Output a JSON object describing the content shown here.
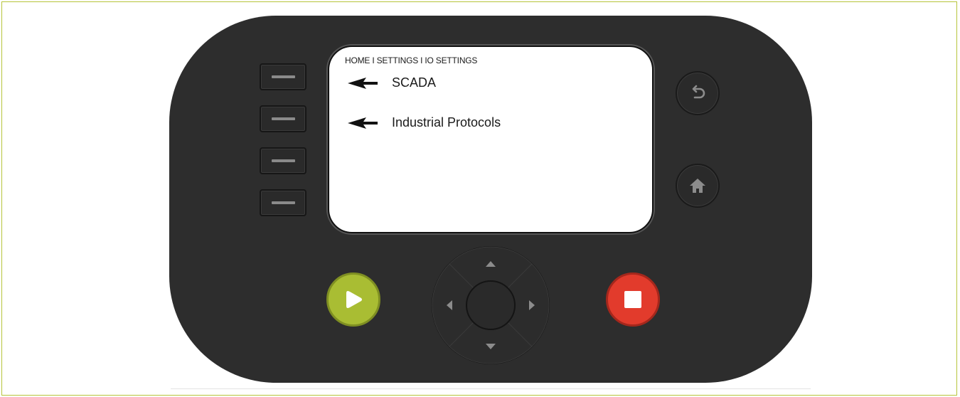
{
  "screen": {
    "breadcrumb": "HOME I SETTINGS I IO SETTINGS",
    "menu_items": [
      {
        "label": "SCADA"
      },
      {
        "label": "Industrial Protocols"
      }
    ]
  },
  "colors": {
    "frame_border": "#b6c43a",
    "device_body": "#2d2d2d",
    "start_button": "#a9bd33",
    "stop_button": "#e23b2c"
  },
  "icons": {
    "softkeys": "dash-icon",
    "back": "back-arrow-icon",
    "home": "home-icon",
    "start": "play-icon",
    "stop": "stop-square-icon",
    "dpad": [
      "arrow-up-icon",
      "arrow-down-icon",
      "arrow-left-icon",
      "arrow-right-icon"
    ]
  }
}
